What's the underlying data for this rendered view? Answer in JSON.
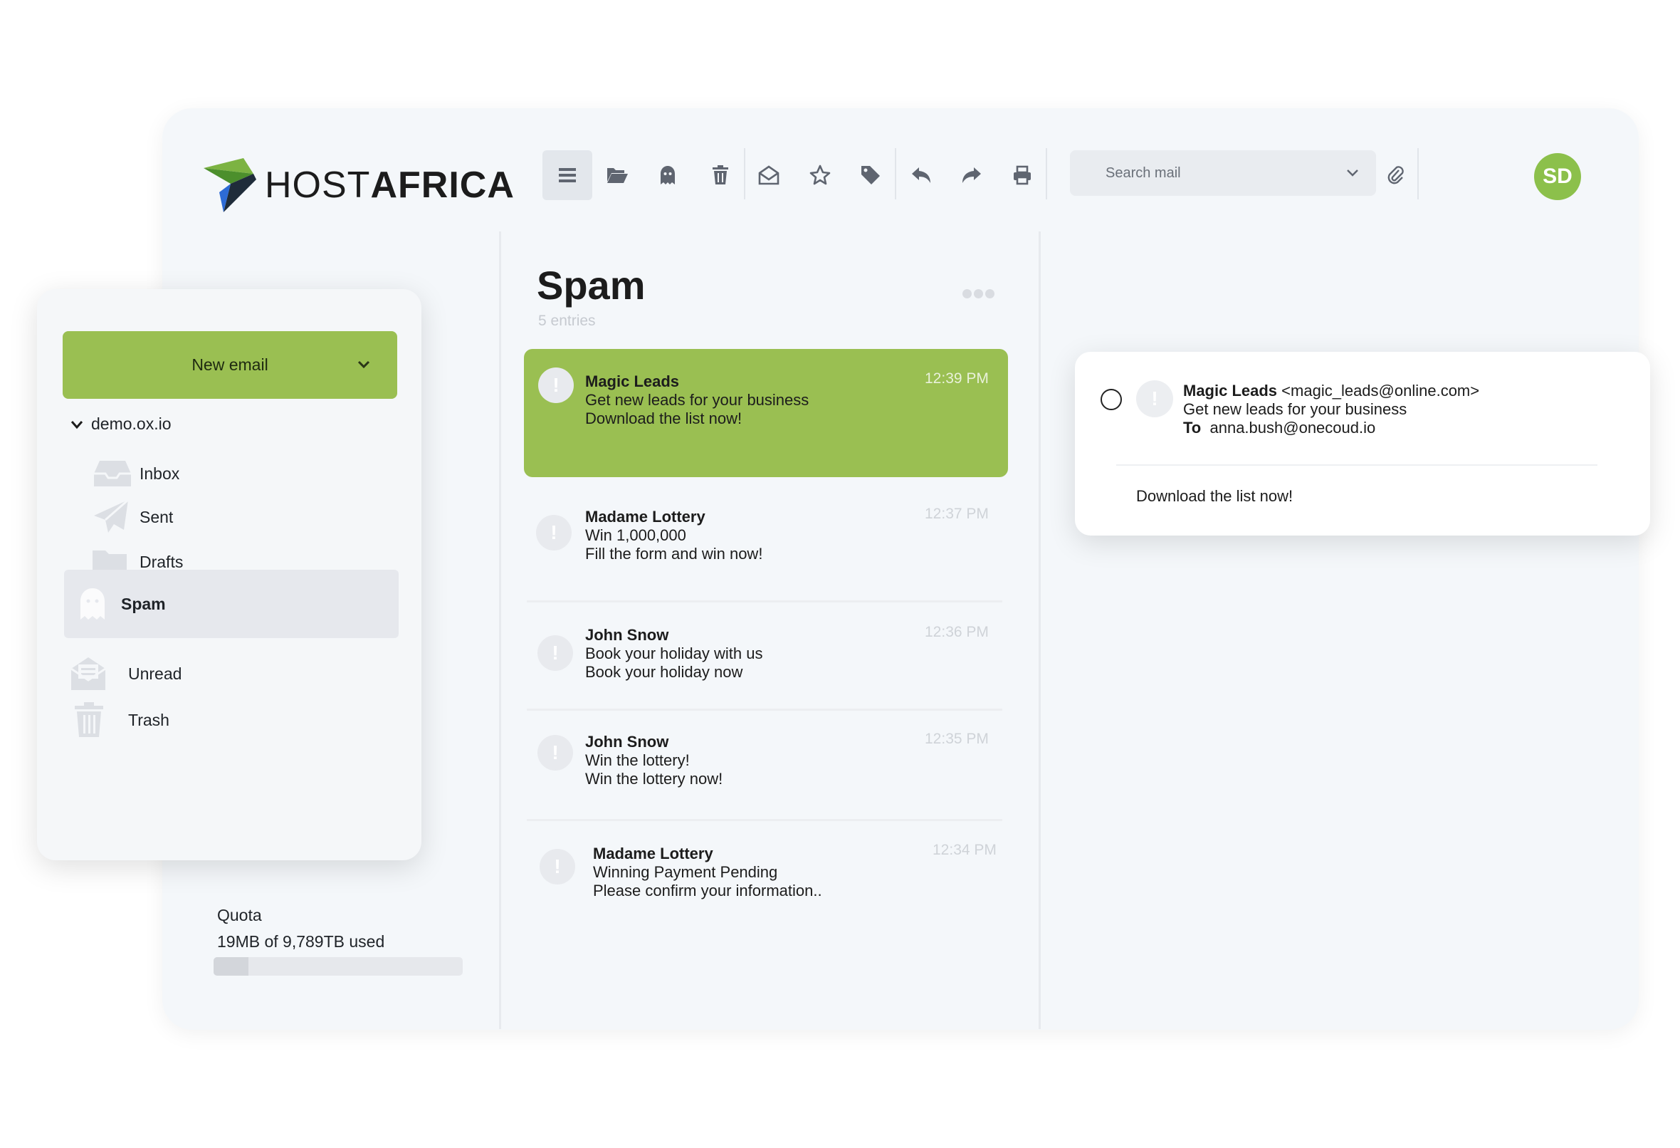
{
  "brand": {
    "name_light": "HOST",
    "name_bold": "AFRICA"
  },
  "toolbar": {
    "buttons": [
      {
        "name": "menu-icon"
      },
      {
        "name": "folder-open-icon"
      },
      {
        "name": "ghost-spam-icon"
      },
      {
        "name": "trash-icon"
      },
      {
        "name": "mark-read-icon"
      },
      {
        "name": "star-icon"
      },
      {
        "name": "tag-icon"
      },
      {
        "name": "reply-icon"
      },
      {
        "name": "forward-icon"
      },
      {
        "name": "print-icon"
      }
    ],
    "search_placeholder": "Search mail",
    "attach_icon": "paperclip-icon"
  },
  "user": {
    "initials": "SD",
    "avatar_color": "#8cc04b"
  },
  "sidebar": {
    "new_email_label": "New email",
    "account": "demo.ox.io",
    "items": [
      {
        "label": "Inbox",
        "icon": "inbox-icon"
      },
      {
        "label": "Sent",
        "icon": "paper-plane-icon"
      },
      {
        "label": "Drafts",
        "icon": "folder-icon"
      },
      {
        "label": "Spam",
        "icon": "ghost-icon",
        "active": true
      },
      {
        "label": "Unread",
        "icon": "envelope-open-icon"
      },
      {
        "label": "Trash",
        "icon": "trash-icon"
      }
    ],
    "quota_label": "Quota",
    "quota_text": "19MB of 9,789TB used",
    "quota_fraction": 0.14
  },
  "list": {
    "title": "Spam",
    "count": "5 entries",
    "mails": [
      {
        "from": "Magic Leads",
        "subject": "Get new leads for your business",
        "preview": "Download the list now!",
        "time": "12:39 PM",
        "selected": true
      },
      {
        "from": "Madame Lottery",
        "subject": "Win 1,000,000",
        "preview": "Fill the form and win now!",
        "time": "12:37 PM"
      },
      {
        "from": "John Snow",
        "subject": "Book your holiday with us",
        "preview": "Book your holiday now",
        "time": "12:36 PM"
      },
      {
        "from": "John Snow",
        "subject": "Win the lottery!",
        "preview": "Win the lottery now!",
        "time": "12:35 PM"
      },
      {
        "from": "Madame Lottery",
        "subject": "Winning Payment Pending",
        "preview": "Please confirm your information..",
        "time": "12:34 PM"
      }
    ]
  },
  "preview": {
    "from_name": "Magic Leads",
    "from_email": "<magic_leads@online.com>",
    "subject": "Get new leads for your business",
    "to_label": "To",
    "to_email": "anna.bush@onecoud.io",
    "body": "Download the list now!"
  },
  "colors": {
    "accent": "#9abf52",
    "background": "#f4f7fa"
  }
}
